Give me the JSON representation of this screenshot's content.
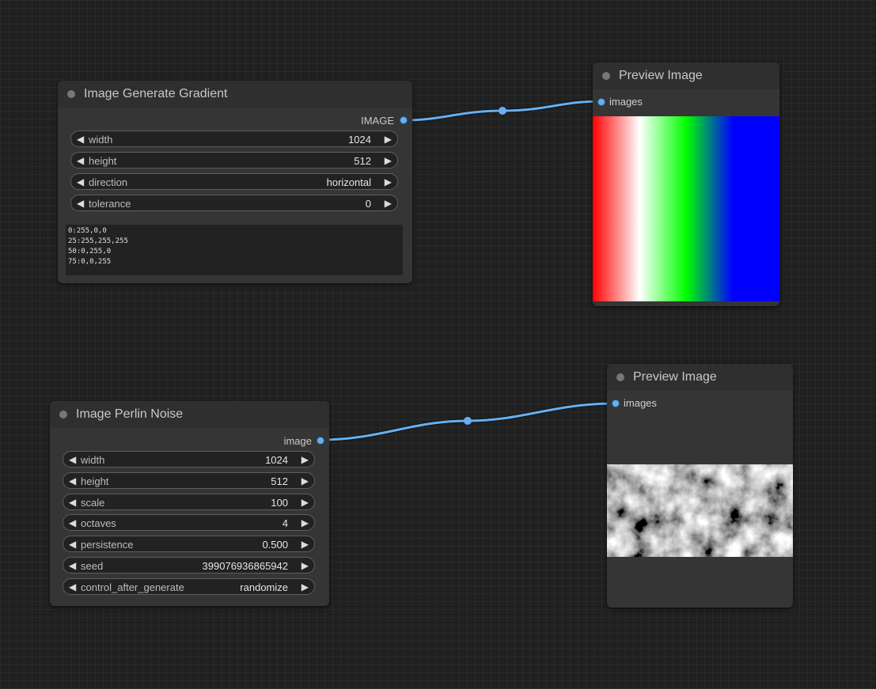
{
  "nodes": {
    "gradient": {
      "title": "Image Generate Gradient",
      "output_label": "IMAGE",
      "widgets": [
        {
          "label": "width",
          "value": "1024"
        },
        {
          "label": "height",
          "value": "512"
        },
        {
          "label": "direction",
          "value": "horizontal"
        },
        {
          "label": "tolerance",
          "value": "0"
        }
      ],
      "gradient_text": [
        "0:255,0,0",
        "25:255,255,255",
        "50:0,255,0",
        "75:0,0,255"
      ]
    },
    "perlin": {
      "title": "Image Perlin Noise",
      "output_label": "image",
      "widgets": [
        {
          "label": "width",
          "value": "1024"
        },
        {
          "label": "height",
          "value": "512"
        },
        {
          "label": "scale",
          "value": "100"
        },
        {
          "label": "octaves",
          "value": "4"
        },
        {
          "label": "persistence",
          "value": "0.500"
        },
        {
          "label": "seed",
          "value": "399076936865942"
        },
        {
          "label": "control_after_generate",
          "value": "randomize"
        }
      ]
    },
    "preview1": {
      "title": "Preview Image",
      "input_label": "images"
    },
    "preview2": {
      "title": "Preview Image",
      "input_label": "images"
    }
  },
  "icons": {
    "decrement": "◀",
    "increment": "▶"
  },
  "colors": {
    "canvas_bg": "#202020",
    "node_bg": "#353535",
    "link": "#66b0f0",
    "gradient_stops": [
      "#ff0000",
      "#ffffff",
      "#00ff00",
      "#0000ff"
    ]
  }
}
